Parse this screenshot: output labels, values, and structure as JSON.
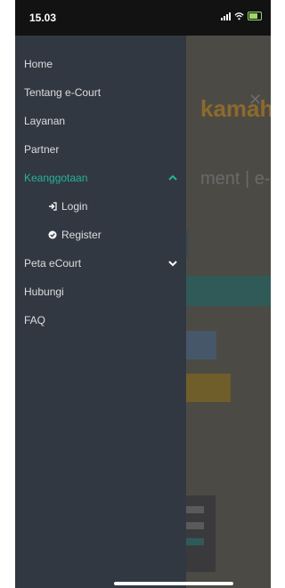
{
  "status_bar": {
    "time": "15.03"
  },
  "menu": {
    "items": [
      {
        "label": "Home"
      },
      {
        "label": "Tentang e-Court"
      },
      {
        "label": "Layanan"
      },
      {
        "label": "Partner"
      },
      {
        "label": "Keanggotaan",
        "expanded": true,
        "icon": "chevron-up-icon"
      },
      {
        "label": "Login",
        "sub": true,
        "icon": "login-icon"
      },
      {
        "label": "Register",
        "sub": true,
        "icon": "check-circle-icon"
      },
      {
        "label": "Peta eCourt",
        "expanded": false,
        "icon": "chevron-down-icon"
      },
      {
        "label": "Hubungi"
      },
      {
        "label": "FAQ"
      }
    ]
  },
  "background_page": {
    "title": "kamah RI",
    "subtitle": "ment | e- tigation"
  },
  "colors": {
    "active": "#26b39a",
    "sidebar": "#323841"
  }
}
